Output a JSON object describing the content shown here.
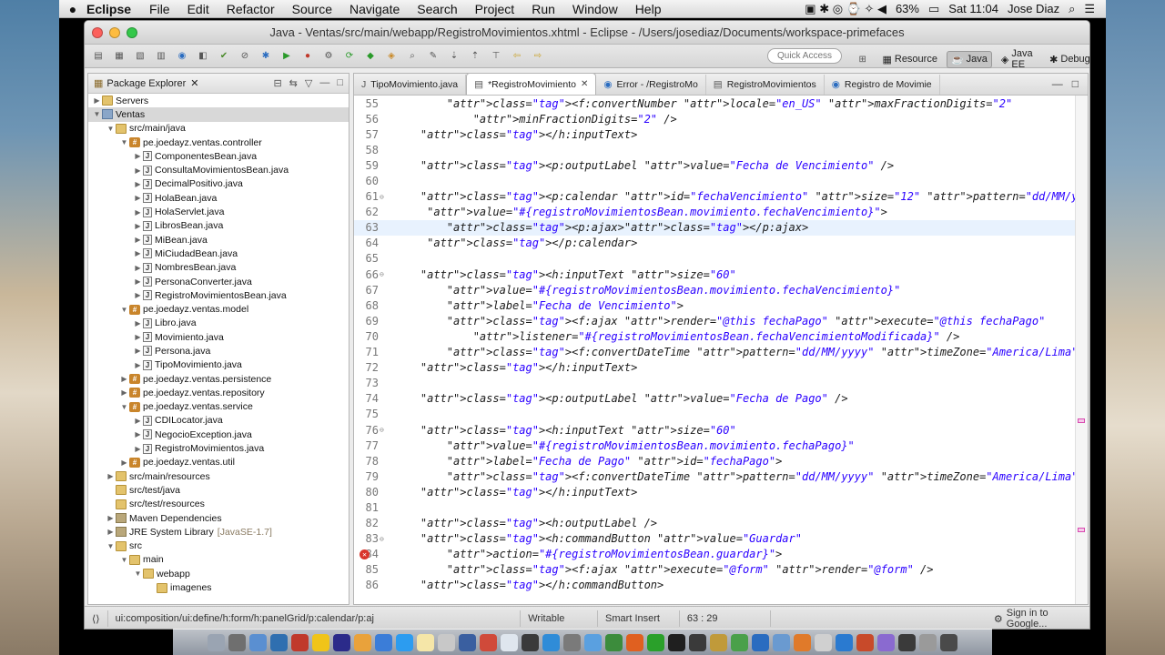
{
  "menubar": {
    "apple": "",
    "app": "Eclipse",
    "items": [
      "File",
      "Edit",
      "Refactor",
      "Source",
      "Navigate",
      "Search",
      "Project",
      "Run",
      "Window",
      "Help"
    ],
    "battery": "63%",
    "clock": "Sat 11:04",
    "user": "Jose Diaz"
  },
  "window": {
    "title": "Java - Ventas/src/main/webapp/RegistroMovimientos.xhtml - Eclipse - /Users/josediaz/Documents/workspace-primefaces"
  },
  "toolbar": {
    "quick_access": "Quick Access",
    "perspectives": [
      "Resource",
      "Java",
      "Java EE",
      "Debug"
    ]
  },
  "package_explorer": {
    "title": "Package Explorer",
    "rows": [
      {
        "label": "Servers",
        "icon": "folder",
        "depth": 0,
        "tw": "▶"
      },
      {
        "label": "Ventas",
        "icon": "project",
        "depth": 0,
        "tw": "▼"
      },
      {
        "label": "src/main/java",
        "icon": "folder",
        "depth": 1,
        "tw": "▼"
      },
      {
        "label": "pe.joedayz.ventas.controller",
        "icon": "package",
        "depth": 2,
        "tw": "▼"
      },
      {
        "label": "ComponentesBean.java",
        "icon": "java",
        "depth": 3,
        "tw": "▶"
      },
      {
        "label": "ConsultaMovimientosBean.java",
        "icon": "java",
        "depth": 3,
        "tw": "▶"
      },
      {
        "label": "DecimalPositivo.java",
        "icon": "java",
        "depth": 3,
        "tw": "▶"
      },
      {
        "label": "HolaBean.java",
        "icon": "java",
        "depth": 3,
        "tw": "▶"
      },
      {
        "label": "HolaServlet.java",
        "icon": "java",
        "depth": 3,
        "tw": "▶"
      },
      {
        "label": "LibrosBean.java",
        "icon": "java",
        "depth": 3,
        "tw": "▶"
      },
      {
        "label": "MiBean.java",
        "icon": "java",
        "depth": 3,
        "tw": "▶"
      },
      {
        "label": "MiCiudadBean.java",
        "icon": "java",
        "depth": 3,
        "tw": "▶"
      },
      {
        "label": "NombresBean.java",
        "icon": "java",
        "depth": 3,
        "tw": "▶"
      },
      {
        "label": "PersonaConverter.java",
        "icon": "java",
        "depth": 3,
        "tw": "▶"
      },
      {
        "label": "RegistroMovimientosBean.java",
        "icon": "java",
        "depth": 3,
        "tw": "▶"
      },
      {
        "label": "pe.joedayz.ventas.model",
        "icon": "package",
        "depth": 2,
        "tw": "▼"
      },
      {
        "label": "Libro.java",
        "icon": "java",
        "depth": 3,
        "tw": "▶"
      },
      {
        "label": "Movimiento.java",
        "icon": "java",
        "depth": 3,
        "tw": "▶"
      },
      {
        "label": "Persona.java",
        "icon": "java",
        "depth": 3,
        "tw": "▶"
      },
      {
        "label": "TipoMovimiento.java",
        "icon": "java",
        "depth": 3,
        "tw": "▶"
      },
      {
        "label": "pe.joedayz.ventas.persistence",
        "icon": "package",
        "depth": 2,
        "tw": "▶"
      },
      {
        "label": "pe.joedayz.ventas.repository",
        "icon": "package",
        "depth": 2,
        "tw": "▶"
      },
      {
        "label": "pe.joedayz.ventas.service",
        "icon": "package",
        "depth": 2,
        "tw": "▼"
      },
      {
        "label": "CDILocator.java",
        "icon": "java",
        "depth": 3,
        "tw": "▶"
      },
      {
        "label": "NegocioException.java",
        "icon": "java",
        "depth": 3,
        "tw": "▶"
      },
      {
        "label": "RegistroMovimientos.java",
        "icon": "java",
        "depth": 3,
        "tw": "▶"
      },
      {
        "label": "pe.joedayz.ventas.util",
        "icon": "package",
        "depth": 2,
        "tw": "▶"
      },
      {
        "label": "src/main/resources",
        "icon": "folder",
        "depth": 1,
        "tw": "▶"
      },
      {
        "label": "src/test/java",
        "icon": "folder",
        "depth": 1,
        "tw": ""
      },
      {
        "label": "src/test/resources",
        "icon": "folder",
        "depth": 1,
        "tw": ""
      },
      {
        "label": "Maven Dependencies",
        "icon": "library",
        "depth": 1,
        "tw": "▶"
      },
      {
        "label": "JRE System Library",
        "icon": "library",
        "depth": 1,
        "tw": "▶",
        "extra": "[JavaSE-1.7]"
      },
      {
        "label": "src",
        "icon": "folder",
        "depth": 1,
        "tw": "▼"
      },
      {
        "label": "main",
        "icon": "folder",
        "depth": 2,
        "tw": "▼"
      },
      {
        "label": "webapp",
        "icon": "folder",
        "depth": 3,
        "tw": "▼"
      },
      {
        "label": "imagenes",
        "icon": "folder",
        "depth": 4,
        "tw": ""
      }
    ]
  },
  "editor": {
    "tabs": [
      {
        "label": "TipoMovimiento.java",
        "active": false
      },
      {
        "label": "*RegistroMovimiento",
        "active": true
      },
      {
        "label": "Error - /RegistroMo",
        "active": false
      },
      {
        "label": "RegistroMovimientos",
        "active": false
      },
      {
        "label": "Registro de Movimie",
        "active": false
      }
    ],
    "lines": [
      {
        "n": "55",
        "t": "        <f:convertNumber locale=\"en_US\" maxFractionDigits=\"2\""
      },
      {
        "n": "56",
        "t": "            minFractionDigits=\"2\" />"
      },
      {
        "n": "57",
        "t": "    </h:inputText>"
      },
      {
        "n": "58",
        "t": ""
      },
      {
        "n": "59",
        "t": "    <p:outputLabel value=\"Fecha de Vencimiento\" />"
      },
      {
        "n": "60",
        "t": ""
      },
      {
        "n": "61",
        "t": "    <p:calendar id=\"fechaVencimiento\" size=\"12\" pattern=\"dd/MM/yyyy\"",
        "fold": true
      },
      {
        "n": "62",
        "t": "     value=\"#{registroMovimientosBean.movimiento.fechaVencimiento}\">"
      },
      {
        "n": "63",
        "t": "        <p:ajax></p:ajax>",
        "cur": true
      },
      {
        "n": "64",
        "t": "     </p:calendar>"
      },
      {
        "n": "65",
        "t": ""
      },
      {
        "n": "66",
        "t": "    <h:inputText size=\"60\"",
        "fold": true
      },
      {
        "n": "67",
        "t": "        value=\"#{registroMovimientosBean.movimiento.fechaVencimiento}\""
      },
      {
        "n": "68",
        "t": "        label=\"Fecha de Vencimiento\">"
      },
      {
        "n": "69",
        "t": "        <f:ajax render=\"@this fechaPago\" execute=\"@this fechaPago\""
      },
      {
        "n": "70",
        "t": "            listener=\"#{registroMovimientosBean.fechaVencimientoModificada}\" />"
      },
      {
        "n": "71",
        "t": "        <f:convertDateTime pattern=\"dd/MM/yyyy\" timeZone=\"America/Lima\" />"
      },
      {
        "n": "72",
        "t": "    </h:inputText>"
      },
      {
        "n": "73",
        "t": ""
      },
      {
        "n": "74",
        "t": "    <p:outputLabel value=\"Fecha de Pago\" />"
      },
      {
        "n": "75",
        "t": ""
      },
      {
        "n": "76",
        "t": "    <h:inputText size=\"60\"",
        "fold": true
      },
      {
        "n": "77",
        "t": "        value=\"#{registroMovimientosBean.movimiento.fechaPago}\""
      },
      {
        "n": "78",
        "t": "        label=\"Fecha de Pago\" id=\"fechaPago\">"
      },
      {
        "n": "79",
        "t": "        <f:convertDateTime pattern=\"dd/MM/yyyy\" timeZone=\"America/Lima\" />"
      },
      {
        "n": "80",
        "t": "    </h:inputText>"
      },
      {
        "n": "81",
        "t": ""
      },
      {
        "n": "82",
        "t": "    <h:outputLabel />"
      },
      {
        "n": "83",
        "t": "    <h:commandButton value=\"Guardar\"",
        "fold": true
      },
      {
        "n": "84",
        "t": "        action=\"#{registroMovimientosBean.guardar}\">",
        "error": true
      },
      {
        "n": "85",
        "t": "        <f:ajax execute=\"@form\" render=\"@form\" />"
      },
      {
        "n": "86",
        "t": "    </h:commandButton>"
      }
    ]
  },
  "status": {
    "breadcrumb": "ui:composition/ui:define/h:form/h:panelGrid/p:calendar/p:aj",
    "writable": "Writable",
    "insert_mode": "Smart Insert",
    "position": "63 : 29",
    "signin": "Sign in to Google..."
  }
}
